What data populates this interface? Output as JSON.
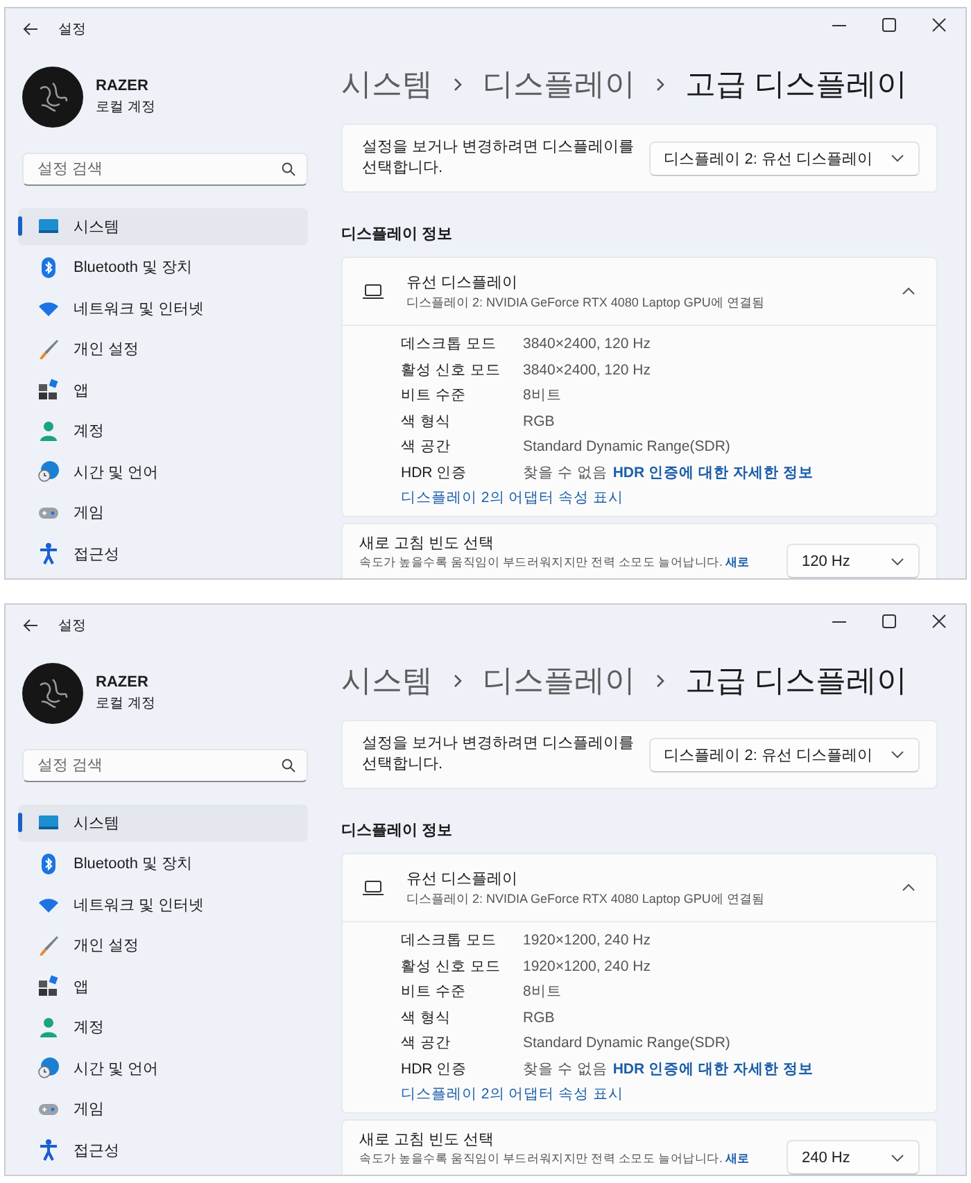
{
  "windows": [
    {
      "title": "설정",
      "account": {
        "name": "RAZER",
        "type": "로컬 계정"
      },
      "search": {
        "placeholder": "설정 검색"
      },
      "nav": [
        {
          "label": "시스템",
          "selected": true
        },
        {
          "label": "Bluetooth 및 장치",
          "selected": false
        },
        {
          "label": "네트워크 및 인터넷",
          "selected": false
        },
        {
          "label": "개인 설정",
          "selected": false
        },
        {
          "label": "앱",
          "selected": false
        },
        {
          "label": "계정",
          "selected": false
        },
        {
          "label": "시간 및 언어",
          "selected": false
        },
        {
          "label": "게임",
          "selected": false
        },
        {
          "label": "접근성",
          "selected": false
        }
      ],
      "breadcrumb": [
        "시스템",
        "디스플레이",
        "고급 디스플레이"
      ],
      "select_display": {
        "text": "설정을 보거나 변경하려면 디스플레이를 선택합니다.",
        "value": "디스플레이 2: 유선 디스플레이"
      },
      "section_title": "디스플레이 정보",
      "display_card": {
        "title": "유선 디스플레이",
        "subtitle": "디스플레이 2: NVIDIA GeForce RTX 4080 Laptop GPU에 연결됨",
        "expanded": true,
        "rows": [
          {
            "label": "데스크톱 모드",
            "value": "3840×2400, 120 Hz"
          },
          {
            "label": "활성 신호 모드",
            "value": "3840×2400, 120 Hz"
          },
          {
            "label": "비트 수준",
            "value": "8비트"
          },
          {
            "label": "색 형식",
            "value": "RGB"
          },
          {
            "label": "색 공간",
            "value": "Standard Dynamic Range(SDR)"
          }
        ],
        "hdr": {
          "label": "HDR 인증",
          "value": "찾을 수 없음",
          "link": "HDR 인증에 대한 자세한 정보"
        },
        "adapter_link": "디스플레이 2의 어댑터 속성 표시"
      },
      "refresh": {
        "title": "새로 고침 빈도 선택",
        "description": "속도가 높을수록 움직임이 부드러워지지만 전력 소모도 늘어납니다.",
        "link": "새로",
        "value": "120 Hz"
      }
    },
    {
      "title": "설정",
      "account": {
        "name": "RAZER",
        "type": "로컬 계정"
      },
      "search": {
        "placeholder": "설정 검색"
      },
      "nav": [
        {
          "label": "시스템",
          "selected": true
        },
        {
          "label": "Bluetooth 및 장치",
          "selected": false
        },
        {
          "label": "네트워크 및 인터넷",
          "selected": false
        },
        {
          "label": "개인 설정",
          "selected": false
        },
        {
          "label": "앱",
          "selected": false
        },
        {
          "label": "계정",
          "selected": false
        },
        {
          "label": "시간 및 언어",
          "selected": false
        },
        {
          "label": "게임",
          "selected": false
        },
        {
          "label": "접근성",
          "selected": false
        }
      ],
      "breadcrumb": [
        "시스템",
        "디스플레이",
        "고급 디스플레이"
      ],
      "select_display": {
        "text": "설정을 보거나 변경하려면 디스플레이를 선택합니다.",
        "value": "디스플레이 2: 유선 디스플레이"
      },
      "section_title": "디스플레이 정보",
      "display_card": {
        "title": "유선 디스플레이",
        "subtitle": "디스플레이 2: NVIDIA GeForce RTX 4080 Laptop GPU에 연결됨",
        "expanded": true,
        "rows": [
          {
            "label": "데스크톱 모드",
            "value": "1920×1200, 240 Hz"
          },
          {
            "label": "활성 신호 모드",
            "value": "1920×1200, 240 Hz"
          },
          {
            "label": "비트 수준",
            "value": "8비트"
          },
          {
            "label": "색 형식",
            "value": "RGB"
          },
          {
            "label": "색 공간",
            "value": "Standard Dynamic Range(SDR)"
          }
        ],
        "hdr": {
          "label": "HDR 인증",
          "value": "찾을 수 없음",
          "link": "HDR 인증에 대한 자세한 정보"
        },
        "adapter_link": "디스플레이 2의 어댑터 속성 표시"
      },
      "refresh": {
        "title": "새로 고침 빈도 선택",
        "description": "속도가 높을수록 움직임이 부드러워지지만 전력 소모도 늘어납니다.",
        "link": "새로",
        "value": "240 Hz"
      }
    }
  ]
}
